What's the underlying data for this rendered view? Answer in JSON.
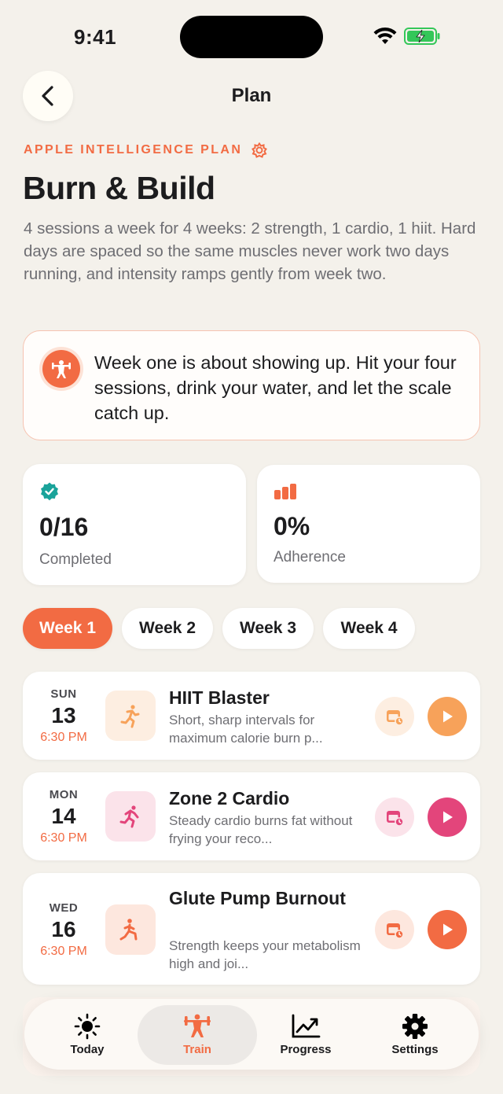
{
  "status": {
    "time": "9:41"
  },
  "nav": {
    "title": "Plan"
  },
  "plan": {
    "eyebrow": "APPLE INTELLIGENCE PLAN",
    "title": "Burn & Build",
    "description": "4 sessions a week for 4 weeks: 2 strength, 1 cardio, 1 hiit. Hard days are spaced so the same muscles never work two days running, and intensity ramps gently from week two.",
    "coach_note": "Week one is about showing up. Hit your four sessions, drink your water, and let the scale catch up."
  },
  "stats": [
    {
      "value": "0/16",
      "label": "Completed"
    },
    {
      "value": "0%",
      "label": "Adherence"
    }
  ],
  "weeks": [
    {
      "label": "Week 1",
      "active": true
    },
    {
      "label": "Week 2",
      "active": false
    },
    {
      "label": "Week 3",
      "active": false
    },
    {
      "label": "Week 4",
      "active": false
    }
  ],
  "sessions": [
    {
      "day": "SUN",
      "date": "13",
      "time": "6:30 PM",
      "name": "HIIT Blaster",
      "desc": "Short, sharp intervals for maximum calorie burn p...",
      "accent": "#f7a25a",
      "icon": "sprint-icon"
    },
    {
      "day": "MON",
      "date": "14",
      "time": "6:30 PM",
      "name": "Zone 2 Cardio",
      "desc": "Steady cardio burns fat without frying your reco...",
      "accent": "#e3457b",
      "icon": "running-icon"
    },
    {
      "day": "WED",
      "date": "16",
      "time": "6:30 PM",
      "name": "Glute Pump Burnout",
      "desc": "Strength keeps your metabolism high and joi...",
      "accent": "#f26b43",
      "icon": "lunge-icon"
    }
  ],
  "tabbar": {
    "items": [
      {
        "label": "Today",
        "icon": "sun-icon"
      },
      {
        "label": "Train",
        "icon": "weightlifter-icon",
        "active": true
      },
      {
        "label": "Progress",
        "icon": "chart-icon"
      },
      {
        "label": "Settings",
        "icon": "gear-icon"
      }
    ]
  },
  "colors": {
    "accent": "#f26b43",
    "background": "#f4f1eb",
    "success": "#1aa39a"
  }
}
